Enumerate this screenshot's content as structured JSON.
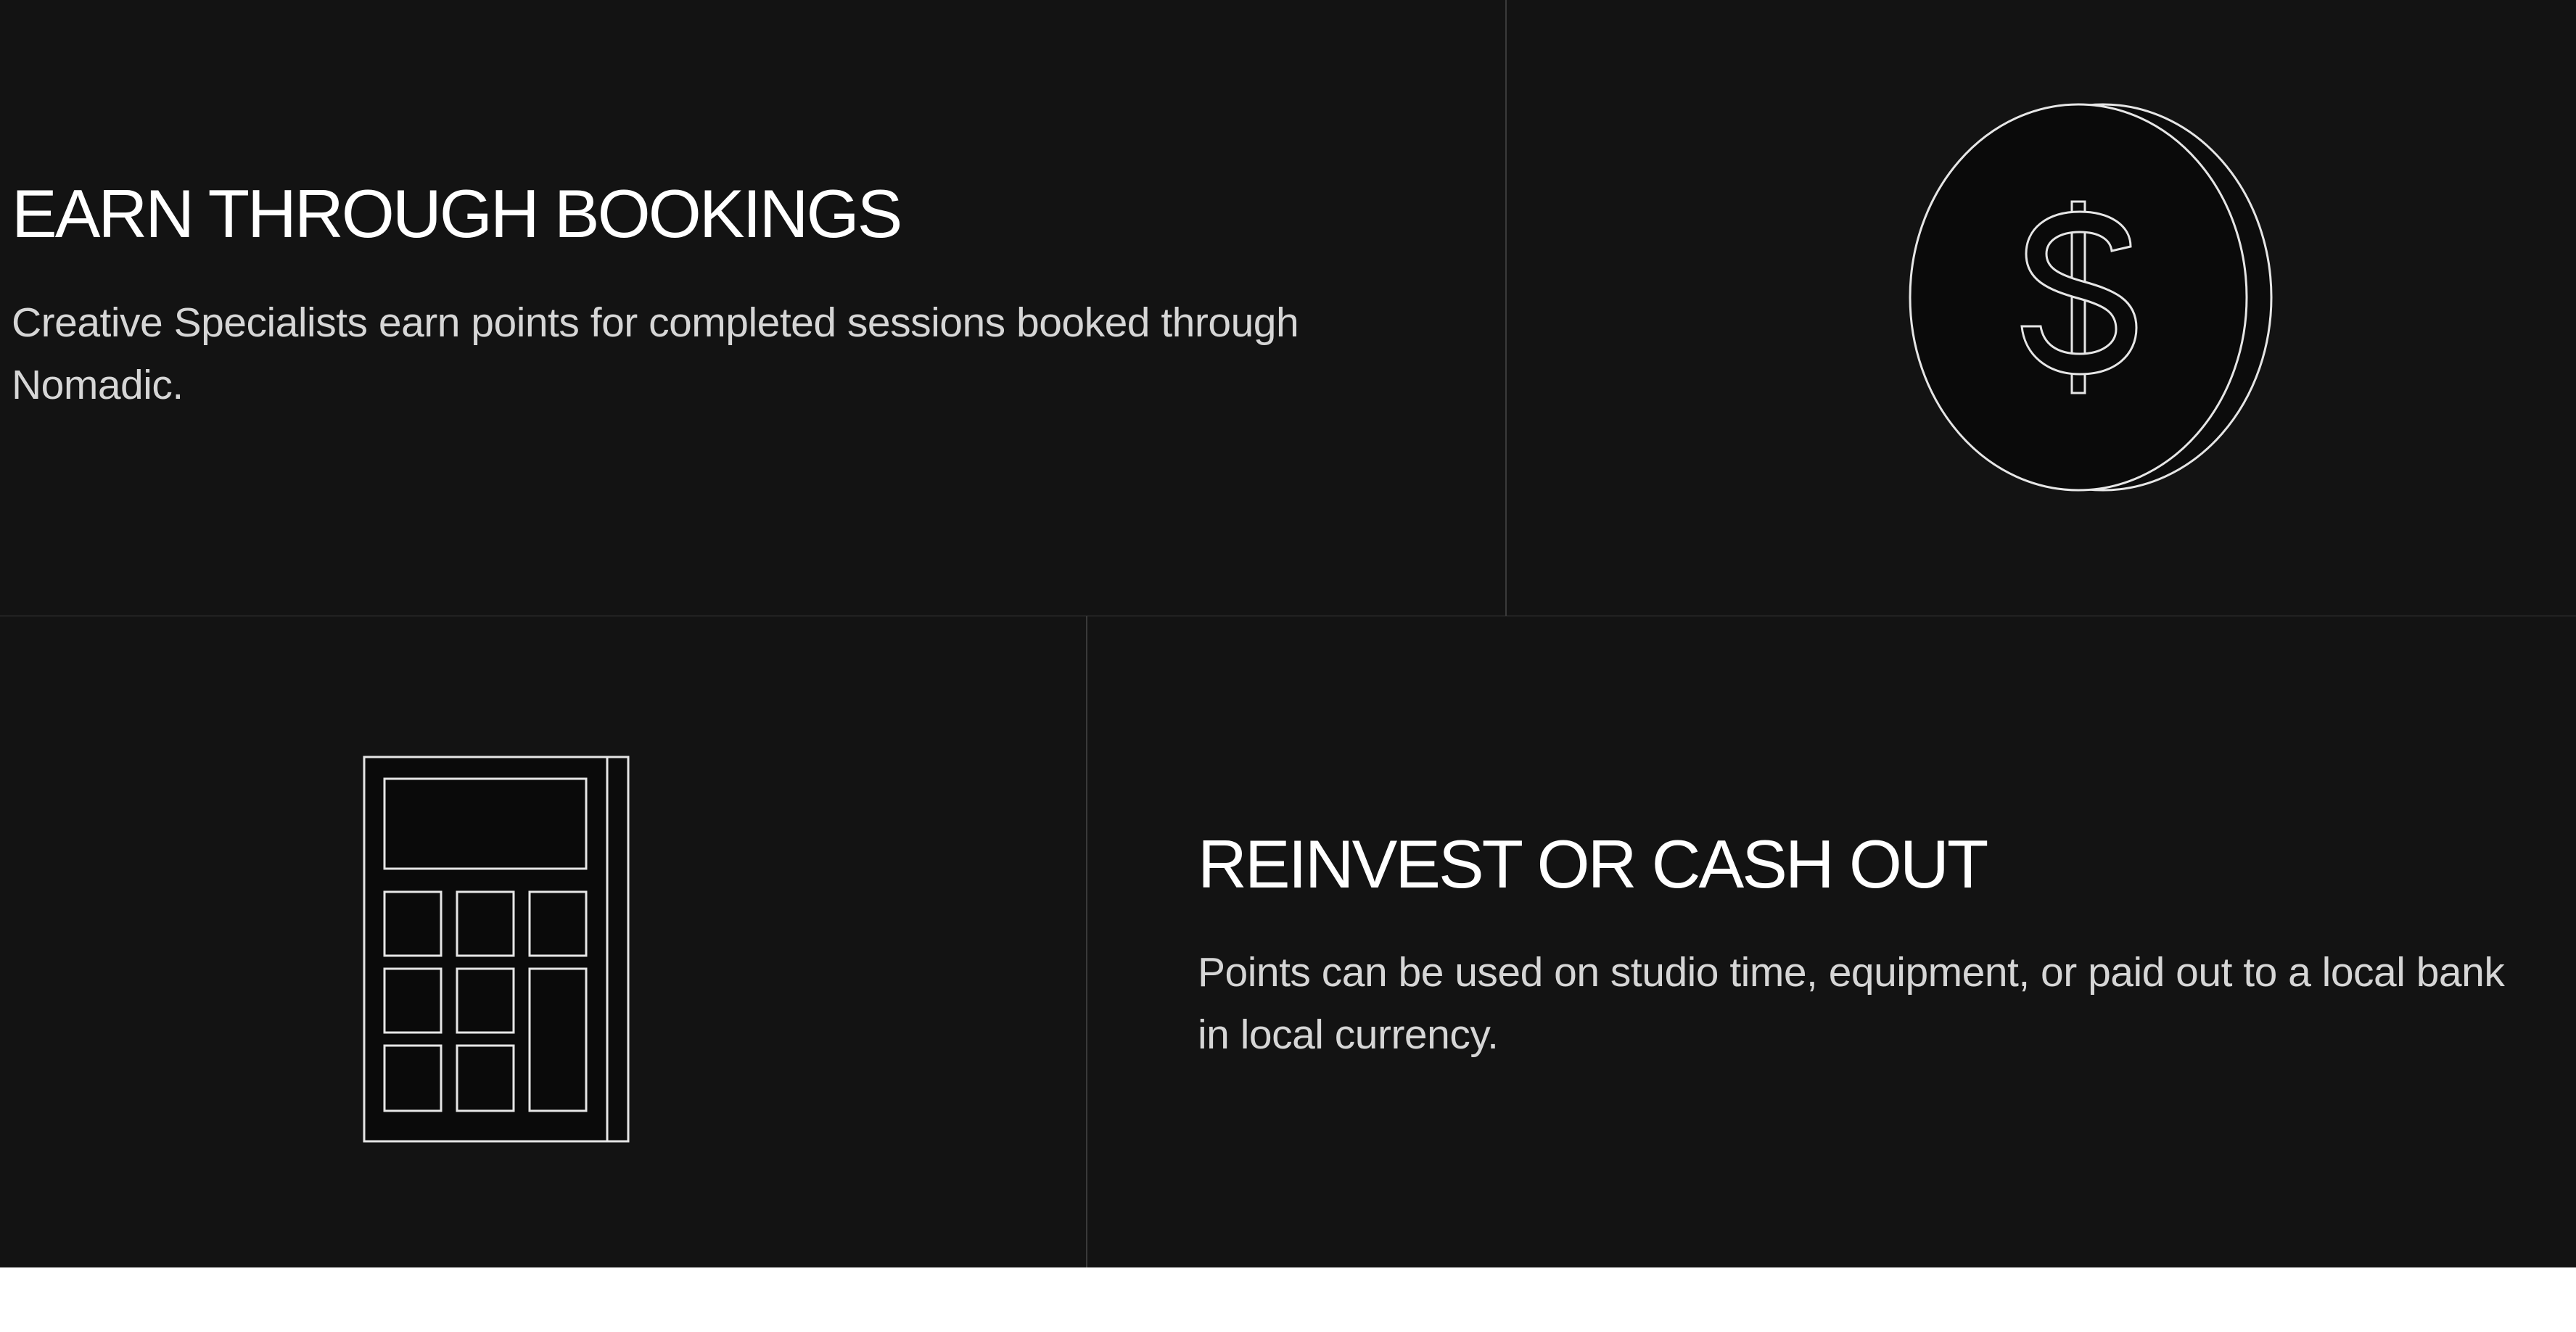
{
  "sections": [
    {
      "title": "EARN THROUGH BOOKINGS",
      "body": "Creative Specialists earn points for completed sessions booked through Nomadic.",
      "icon": "coin-dollar-icon"
    },
    {
      "title": "REINVEST OR CASH OUT",
      "body": " Points can be used on studio time, equipment, or paid out to a local bank in local currency.",
      "icon": "calculator-icon"
    }
  ],
  "colors": {
    "panel_background": "#131313",
    "heading_text": "#ffffff",
    "body_text": "#d6d6d6",
    "divider": "#3a3a3a",
    "icon_stroke": "#e6e6e6",
    "page_background": "#ffffff"
  }
}
